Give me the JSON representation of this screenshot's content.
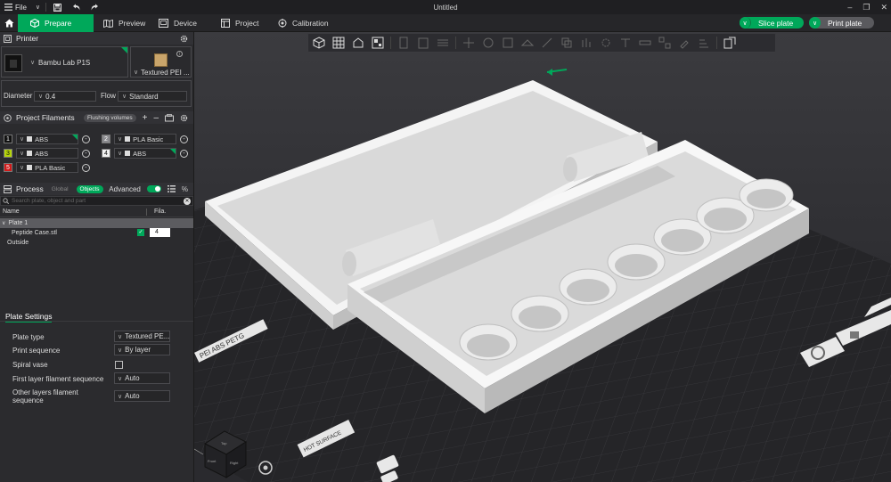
{
  "app": {
    "title": "Untitled",
    "file_menu": "File",
    "accent": "#00a85a"
  },
  "nav": {
    "tabs": [
      {
        "label": "Prepare",
        "icon": "cube-icon",
        "active": true
      },
      {
        "label": "Preview",
        "icon": "preview-icon",
        "active": false
      },
      {
        "label": "Device",
        "icon": "device-icon",
        "active": false
      },
      {
        "label": "Project",
        "icon": "project-icon",
        "active": false
      },
      {
        "label": "Calibration",
        "icon": "calibration-icon",
        "active": false
      }
    ],
    "slice_label": "Slice plate",
    "print_label": "Print plate"
  },
  "printer": {
    "header": "Printer",
    "name": "Bambu Lab P1S",
    "plate": "Textured PEI ...",
    "diameter_label": "Diameter",
    "diameter_value": "0.4",
    "flow_label": "Flow",
    "flow_value": "Standard"
  },
  "filaments": {
    "header": "Project Filaments",
    "flushing_label": "Flushing volumes",
    "items": [
      {
        "num": "1",
        "name": "ABS",
        "color": "#111111",
        "numcolor": "#ffffff"
      },
      {
        "num": "2",
        "name": "PLA Basic",
        "color": "#8a8a8e",
        "numcolor": "#ffffff"
      },
      {
        "num": "3",
        "name": "ABS",
        "color": "#b5d50a",
        "numcolor": "#111111"
      },
      {
        "num": "4",
        "name": "ABS",
        "color": "#f2f2f2",
        "numcolor": "#111111"
      },
      {
        "num": "5",
        "name": "PLA Basic",
        "color": "#d11a1a",
        "numcolor": "#ffffff"
      }
    ]
  },
  "process": {
    "header": "Process",
    "global_label": "Global",
    "objects_label": "Objects",
    "advanced_label": "Advanced",
    "search_placeholder": "Search plate, object and part",
    "col_name": "Name",
    "col_fila": "Fila.",
    "rows": {
      "plate": "Plate 1",
      "object": "Peptide Case.stl",
      "object_fila": "4",
      "outside": "Outside"
    }
  },
  "plate_settings": {
    "header": "Plate Settings",
    "plate_type_label": "Plate type",
    "plate_type_value": "Textured PE...",
    "print_seq_label": "Print sequence",
    "print_seq_value": "By layer",
    "spiral_label": "Spiral vase",
    "first_layer_label": "First layer filament sequence",
    "first_layer_value": "Auto",
    "other_layers_label": "Other layers filament sequence",
    "other_layers_value": "Auto"
  },
  "bed": {
    "marking1": "PEI ABS PETG",
    "marking2": "HOT SURFACE"
  },
  "view_cube": {
    "top": "Top",
    "front": "Front",
    "right": "Right"
  }
}
